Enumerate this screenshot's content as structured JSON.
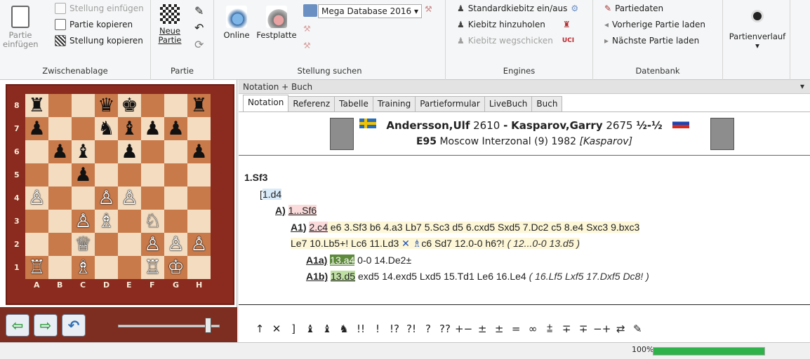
{
  "ribbon": {
    "clipboard": {
      "paste_label": "Partie\neinfügen",
      "insert_position": "Stellung einfügen",
      "copy_game": "Partie kopieren",
      "copy_position": "Stellung kopieren",
      "group_label": "Zwischenablage"
    },
    "game": {
      "new_game_label": "Neue\nPartie",
      "group_label": "Partie"
    },
    "search": {
      "online_label": "Online",
      "harddisk_label": "Festplatte",
      "database_value": "Mega Database 2016",
      "group_label": "Stellung suchen"
    },
    "engines": {
      "toggle_kibitzer": "Standardkiebitz ein/aus",
      "add_kibitzer": "Kiebitz hinzuholen",
      "remove_kibitzer": "Kiebitz wegschicken",
      "uci_label": "UCI",
      "group_label": "Engines"
    },
    "database": {
      "game_data": "Partiedaten",
      "prev_game": "Vorherige Partie laden",
      "next_game": "Nächste Partie laden",
      "group_label": "Datenbank"
    },
    "history": {
      "label": "Partienverlauf"
    }
  },
  "board": {
    "ranks": [
      "8",
      "7",
      "6",
      "5",
      "4",
      "3",
      "2",
      "1"
    ],
    "files": [
      "A",
      "B",
      "C",
      "D",
      "E",
      "F",
      "G",
      "H"
    ],
    "position": [
      [
        "♜",
        "",
        "",
        "♛",
        "♚",
        "",
        "",
        "♜"
      ],
      [
        "♟",
        "",
        "",
        "♞",
        "♝",
        "♟",
        "♟",
        ""
      ],
      [
        "",
        "♟",
        "♝",
        "",
        "♟",
        "",
        "",
        "♟"
      ],
      [
        "",
        "",
        "♟",
        "",
        "",
        "",
        "",
        ""
      ],
      [
        "♙",
        "",
        "",
        "♙",
        "♙",
        "",
        "",
        ""
      ],
      [
        "",
        "",
        "♙",
        "♗",
        "",
        "♘",
        "",
        ""
      ],
      [
        "",
        "",
        "♕",
        "",
        "",
        "♙",
        "♙",
        "♙"
      ],
      [
        "♖",
        "",
        "♗",
        "",
        "",
        "♖",
        "♔",
        ""
      ]
    ]
  },
  "nav": {
    "back_label": "⇦",
    "forward_label": "⇨",
    "undo_label": "↶"
  },
  "panel": {
    "title": "Notation + Buch",
    "tabs": [
      "Notation",
      "Referenz",
      "Tabelle",
      "Training",
      "Partieformular",
      "LiveBuch",
      "Buch"
    ]
  },
  "game": {
    "white": "Andersson,Ulf",
    "white_elo": "2610",
    "black": "Kasparov,Garry",
    "black_elo": "2675",
    "result": "½-½",
    "eco": "E95",
    "event": "Moscow Interzonal (9) 1982",
    "annotator": "[Kasparov]"
  },
  "notation": {
    "l1": "1.Sf3",
    "l2": "1.d4",
    "l3_label": "A)",
    "l3_move": "1...Sf6",
    "l4_label": "A1)",
    "l4_move": "2.c4",
    "l4_rest": " e6 3.Sf3 b6 4.a3 Lb7 5.Sc3 d5 6.cxd5 Sxd5 7.Dc2 c5 8.e4 Sxc3 9.bxc3",
    "l5_text": "Le7 10.Lb5+! Lc6 11.Ld3",
    "l5_mark": "✕",
    "l5_piece": "♗",
    "l5_text2": "c6 Sd7 12.0-0 h6?!",
    "l5_comment": "( 12...0-0 13.d5 )",
    "l6_label": "A1a)",
    "l6_move": "13.a4",
    "l6_rest": " 0-0 14.De2±",
    "l7_label": "A1b)",
    "l7_move": "13.d5",
    "l7_rest": " exd5 14.exd5 Lxd5 15.Td1 Le6 16.Le4",
    "l7_comment": "( 16.Lf5 Lxf5 17.Dxf5 Dc8! )"
  },
  "symbols": [
    "↑",
    "✕",
    "]",
    "♝",
    "♝",
    "♞",
    "!!",
    "!",
    "!?",
    "?!",
    "?",
    "??",
    "+−",
    "±",
    "±",
    "=",
    "∞",
    "⩲",
    "∓",
    "∓",
    "−+",
    "⇄",
    "✎"
  ],
  "status": {
    "progress_text": "100%",
    "progress": 1.0
  }
}
